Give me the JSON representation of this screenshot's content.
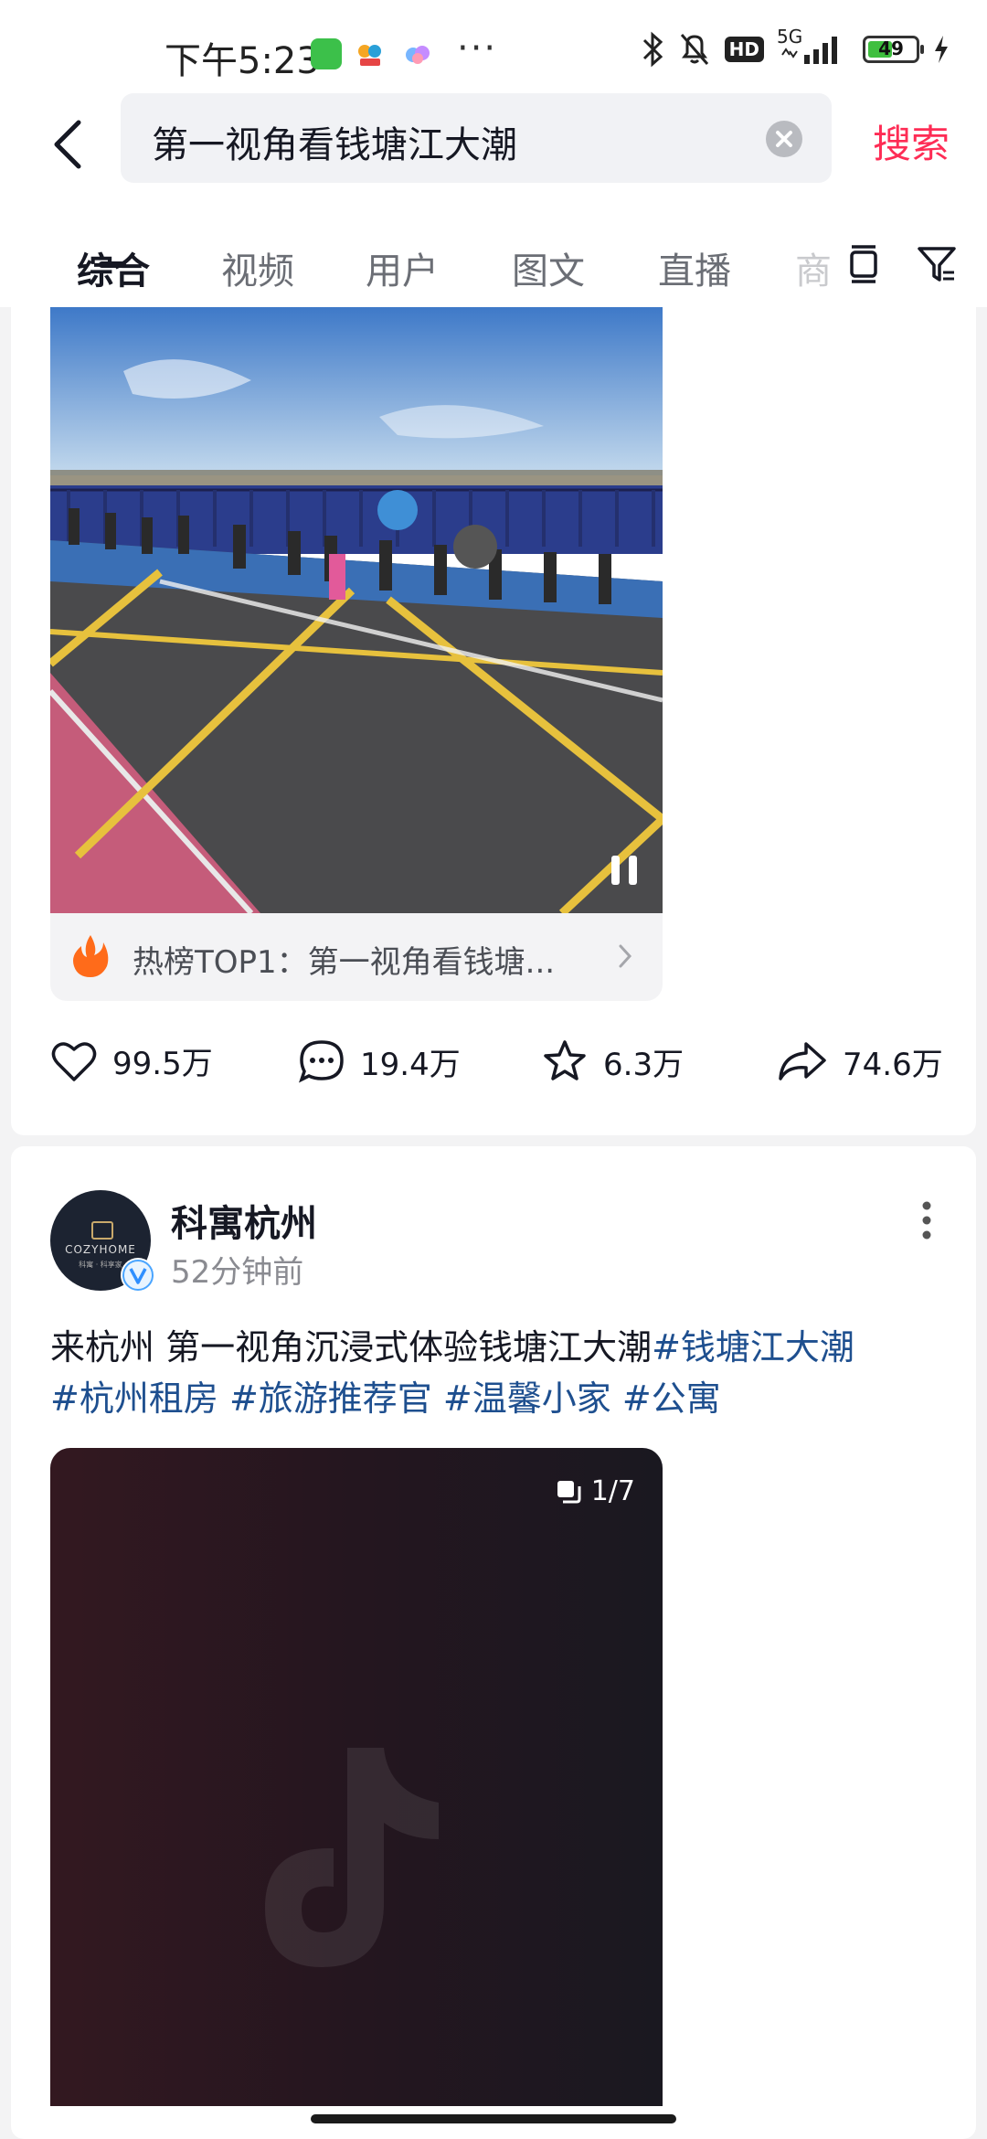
{
  "status_bar": {
    "time": "下午5:23",
    "network": "5G",
    "hd_label": "HD",
    "battery": "49",
    "more": "···"
  },
  "search": {
    "query": "第一视角看钱塘江大潮",
    "submit_label": "搜索"
  },
  "tabs": [
    "综合",
    "视频",
    "用户",
    "图文",
    "直播"
  ],
  "tab_partial": "商",
  "post1": {
    "hot_label": "热榜TOP1：第一视角看钱塘...",
    "likes": "99.5万",
    "comments": "19.4万",
    "favorites": "6.3万",
    "shares": "74.6万"
  },
  "post2": {
    "author": "科寓杭州",
    "avatar_text": "COZYHOME",
    "avatar_subtext": "科寓 · 科享家",
    "time": "52分钟前",
    "desc_text": "来杭州 第一视角沉浸式体验钱塘江大潮",
    "tags": [
      "#钱塘江大潮",
      "#杭州租房",
      "#旅游推荐官",
      "#温馨小家",
      "#公寓"
    ],
    "album_count": "1/7"
  },
  "colors": {
    "accent": "#fe2c55",
    "hashtag": "#1e4f8f"
  }
}
